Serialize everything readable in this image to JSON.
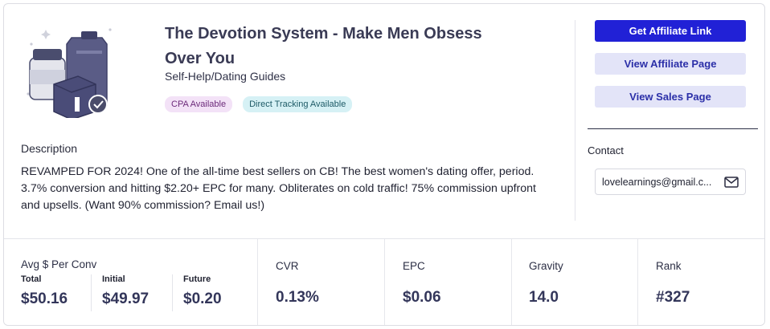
{
  "product": {
    "title": "The Devotion System - Make Men Obsess Over You",
    "category": "Self-Help/Dating Guides",
    "badges": {
      "cpa": "CPA Available",
      "tracking": "Direct Tracking Available"
    },
    "image_icon": "product-package-illustration"
  },
  "description": {
    "heading": "Description",
    "text": "REVAMPED FOR 2024! One of the all-time best sellers on CB! The best women's dating offer, period. 3.7% conversion and hitting $2.20+ EPC for many. Obliterates on cold traffic! 75% commission upfront and upsells. (Want 90% commission? Email us!)"
  },
  "actions": {
    "get_link": "Get Affiliate Link",
    "affiliate_page": "View Affiliate Page",
    "sales_page": "View Sales Page"
  },
  "contact": {
    "label": "Contact",
    "email": "lovelearnings@gmail.c...",
    "icon": "mail-icon"
  },
  "stats": {
    "avg": {
      "label": "Avg $ Per Conv",
      "total_label": "Total",
      "total_value": "$50.16",
      "initial_label": "Initial",
      "initial_value": "$49.97",
      "future_label": "Future",
      "future_value": "$0.20"
    },
    "cvr": {
      "label": "CVR",
      "value": "0.13%"
    },
    "epc": {
      "label": "EPC",
      "value": "$0.06"
    },
    "gravity": {
      "label": "Gravity",
      "value": "14.0"
    },
    "rank": {
      "label": "Rank",
      "value": "#327"
    }
  },
  "colors": {
    "primary_button": "#2121d6",
    "secondary_button": "#e3e4f8",
    "badge_cpa_bg": "#f3e2f7",
    "badge_tracking_bg": "#d6f1f5"
  }
}
